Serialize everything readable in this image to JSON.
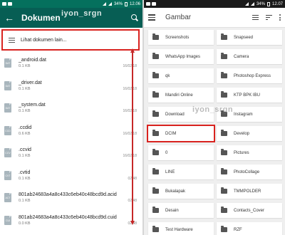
{
  "left": {
    "status": {
      "battery": "34%",
      "time": "12.06"
    },
    "title": "Dokumen",
    "watermark": "iyon_srgn",
    "more_label": "Lihat dokumen lain...",
    "files": [
      {
        "icon": "DAT",
        "name": "_android.dat",
        "size": "0.1 KB",
        "date": "16/02/18"
      },
      {
        "icon": "DAT",
        "name": "_driver.dat",
        "size": "0.1 KB",
        "date": "16/02/18"
      },
      {
        "icon": "DAT",
        "name": "_system.dat",
        "size": "0.1 KB",
        "date": "16/02/18"
      },
      {
        "icon": "CCD",
        "name": ".ccdid",
        "size": "0.6 KB",
        "date": "16/02/18"
      },
      {
        "icon": "CCV",
        "name": ".ccvid",
        "size": "0.1 KB",
        "date": "16/02/18"
      },
      {
        "icon": "CVT",
        "name": ".cvtid",
        "size": "0.1 KB",
        "date": "02.48"
      },
      {
        "icon": "ACT",
        "name": "801ab24683a4a8c433c6eb40c48bcd9d.acid",
        "size": "0.1 KB",
        "date": "02.48"
      },
      {
        "icon": "CUI",
        "name": "801ab24683a4a8c433c6eb40c48bcd9d.cuid",
        "size": "0.0 KB",
        "date": "02.48"
      }
    ]
  },
  "right": {
    "status": {
      "battery": "34%",
      "time": "12.07"
    },
    "title": "Gambar",
    "watermark": "iyon_srgn",
    "folders": [
      "Screenshots",
      "Snapseed",
      "WhatsApp Images",
      "Camera",
      "qk",
      "Photoshop Express",
      "Mandiri Online",
      "KTP BPK IBU",
      "Download",
      "Instagram",
      "DCIM",
      "Develop",
      "0",
      "Pictures",
      "LINE",
      "PhotoCollage",
      "Bukalapak",
      "TMMPOLDER",
      "Desain",
      "Contacts_Cover",
      "Test Hardware",
      "RZF"
    ]
  },
  "colors": {
    "whatsapp_green": "#075e54",
    "highlight_red": "#d9231f"
  }
}
